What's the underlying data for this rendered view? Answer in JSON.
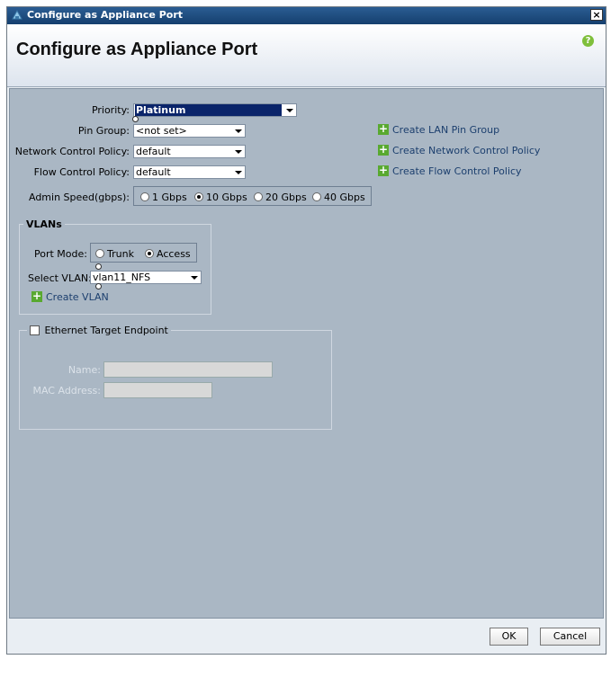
{
  "window": {
    "title": "Configure as Appliance Port",
    "heading": "Configure as Appliance Port",
    "close_label": "×",
    "help_label": "?"
  },
  "form": {
    "priority_label": "Priority:",
    "priority_value": "Platinum",
    "pin_group_label": "Pin Group:",
    "pin_group_value": "<not set>",
    "network_control_label": "Network Control Policy:",
    "network_control_value": "default",
    "flow_control_label": "Flow Control Policy:",
    "flow_control_value": "default",
    "admin_speed_label": "Admin Speed(gbps):",
    "admin_speed_options": [
      "1 Gbps",
      "10 Gbps",
      "20 Gbps",
      "40 Gbps"
    ],
    "admin_speed_selected": "10 Gbps"
  },
  "links": {
    "create_lan_pin_group": "Create LAN Pin Group",
    "create_network_control_policy": "Create Network Control Policy",
    "create_flow_control_policy": "Create Flow Control Policy"
  },
  "vlans": {
    "legend": "VLANs",
    "port_mode_label": "Port Mode:",
    "port_mode_options": [
      "Trunk",
      "Access"
    ],
    "port_mode_selected": "Access",
    "select_vlan_label": "Select VLAN:",
    "select_vlan_value": "vlan11_NFS",
    "create_vlan": "Create VLAN"
  },
  "ethernet_target": {
    "legend": "Ethernet Target Endpoint",
    "checked": false,
    "name_label": "Name:",
    "name_value": "",
    "mac_label": "MAC Address:",
    "mac_value": ""
  },
  "buttons": {
    "ok": "OK",
    "cancel": "Cancel"
  },
  "colors": {
    "content_bg": "#aab7c4",
    "title_bar": "#1f4d80",
    "plus_icon": "#59a930",
    "selection": "#0a246a"
  }
}
